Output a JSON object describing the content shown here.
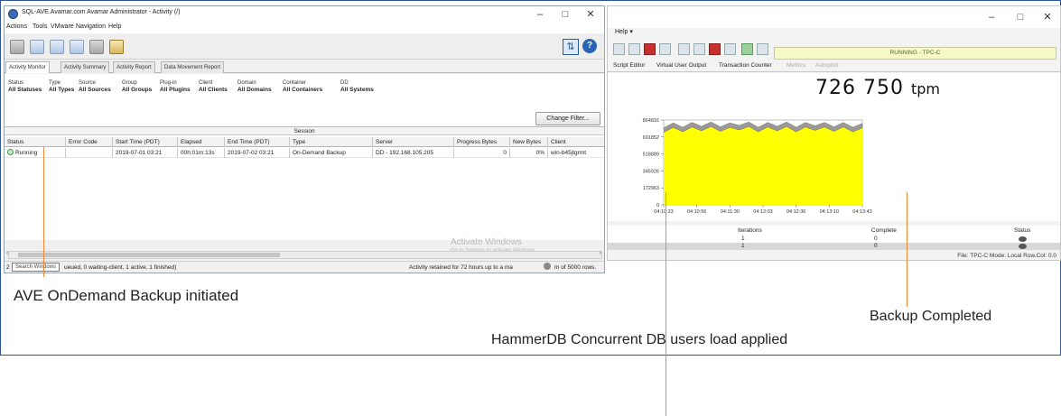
{
  "left_window": {
    "title": "SQL-AVE.Avamar.com Avamar Administrator - Activity (/)",
    "menu": [
      "Actions",
      "Tools",
      "VMware",
      "Navigation",
      "Help"
    ],
    "tabs": [
      "Activity Monitor",
      "Activity Summary",
      "Activity Report",
      "Data Movement Report"
    ],
    "active_tab": "Activity Monitor",
    "filters": [
      {
        "label": "Status",
        "value": "All Statuses"
      },
      {
        "label": "Type",
        "value": "All Types"
      },
      {
        "label": "Source",
        "value": "All Sources"
      },
      {
        "label": "Group",
        "value": "All Groups"
      },
      {
        "label": "Plug-in",
        "value": "All Plugins"
      },
      {
        "label": "Client",
        "value": "All Clients"
      },
      {
        "label": "Domain",
        "value": "All Domains"
      },
      {
        "label": "Container",
        "value": "All Containers"
      },
      {
        "label": "DD",
        "value": "All Systems"
      }
    ],
    "change_filter": "Change Filter...",
    "session_header": "Session",
    "columns": [
      "Status",
      "Error Code",
      "Start Time (PDT)",
      "Elapsed",
      "End Time (PDT)",
      "Type",
      "Server",
      "Progress Bytes",
      "New Bytes",
      "Client"
    ],
    "rows": [
      [
        "Running",
        "",
        "2019-07-01 03:21",
        "00h:01m:13s",
        "2019-07-02 03:21",
        "On-Demand Backup",
        "DD - 192.168.105.205",
        "0",
        "0%",
        "win-b45jtgrmt"
      ]
    ],
    "status_left": "ueued, 0 waiting-client, 1 active, 1 finished)",
    "status_left_prefix": "2",
    "status_right": "Activity retained for 72 hours up to a ma",
    "status_right_tail": "m of 5000 rows.",
    "tooltip": "Search Windows",
    "activate_title": "Activate Windows",
    "activate_sub": "Go to Settings to activate Windows.",
    "controls": {
      "minimize": "–",
      "maximize": "□",
      "close": "✕"
    }
  },
  "right_window": {
    "menu_help": "Help",
    "running_status": "RUNNING - TPC-C",
    "tabs": [
      "Script Editor",
      "Virtual User Output",
      "Transaction Counter",
      "Metrics",
      "Autopilot"
    ],
    "tpm_value": "726 750",
    "tpm_unit": "tpm",
    "table_headers": [
      "Iterations",
      "Complete",
      "Status"
    ],
    "table_rows": [
      [
        "1",
        "0"
      ],
      [
        "1",
        "0"
      ]
    ],
    "status_bar": "File: TPC-C  Mode: Local  Row.Col: 0.0",
    "controls": {
      "minimize": "–",
      "maximize": "□",
      "close": "✕"
    }
  },
  "chart_data": {
    "type": "area",
    "title": "",
    "xlabel": "",
    "ylabel": "",
    "x": [
      "04:10:23",
      "04:10:56",
      "04:11:30",
      "04:12:03",
      "04:12:36",
      "04:13:10",
      "04:13:43"
    ],
    "y_ticks": [
      0,
      172963,
      345926,
      518889,
      691852,
      864816
    ],
    "ylim": [
      0,
      864816
    ],
    "fill_color": "#ffff00",
    "line_color": "#555555",
    "series": [
      {
        "values": [
          785000,
          835000,
          790000,
          840000,
          800000,
          845000,
          795000,
          835000,
          810000,
          845000,
          790000,
          840000,
          800000,
          845000,
          790000,
          840000,
          805000,
          840000,
          795000,
          840000,
          790000,
          830000
        ]
      }
    ]
  },
  "annotations": {
    "left": "AVE OnDemand Backup initiated",
    "center": "HammerDB Concurrent DB users load applied",
    "right": "Backup Completed"
  }
}
